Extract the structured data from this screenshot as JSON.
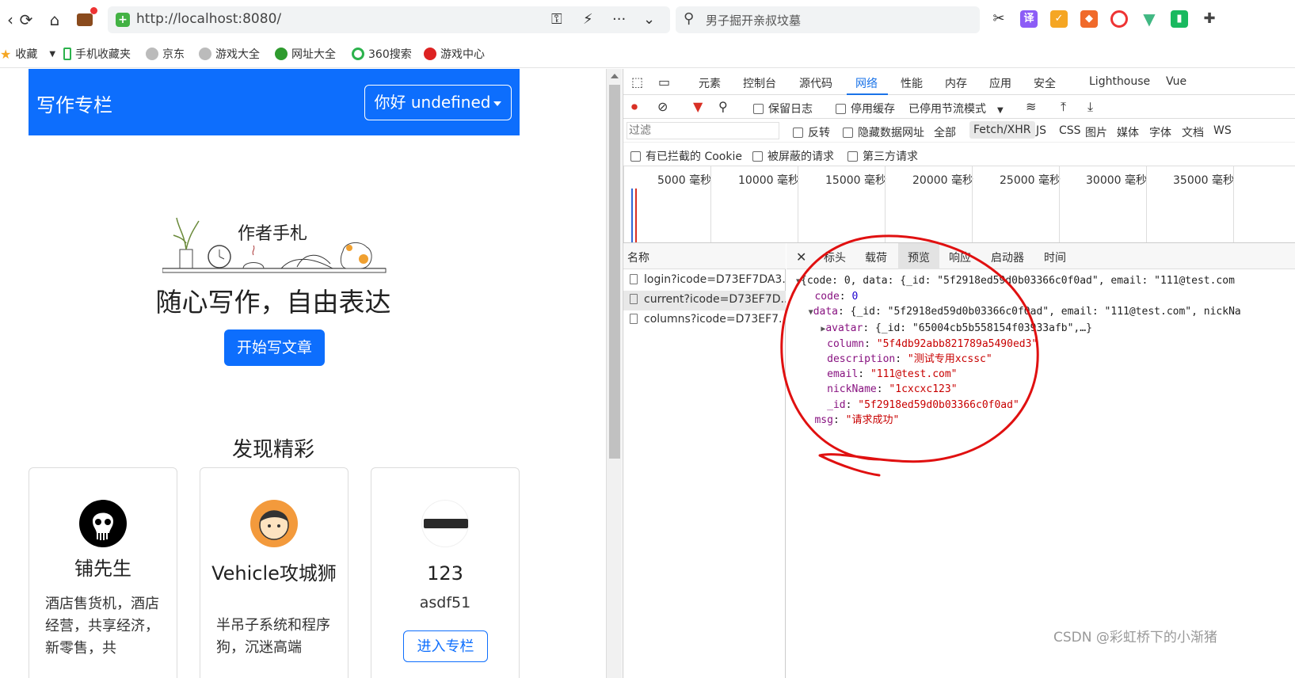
{
  "browser": {
    "url": "http://localhost:8080/",
    "search_text": "男子掘开亲叔坟墓",
    "bookmarks": [
      "收藏",
      "手机收藏夹",
      "京东",
      "游戏大全",
      "网址大全",
      "360搜索",
      "游戏中心"
    ]
  },
  "page": {
    "brand": "写作专栏",
    "user_dropdown": "你好 undefined",
    "hero_small": "作者手札",
    "hero_title": "随心写作，自由表达",
    "start_button": "开始写文章",
    "section_title": "发现精彩",
    "cards": [
      {
        "title": "铺先生",
        "desc": "酒店售货机，酒店经营，共享经济，新零售，共",
        "avatar": "skull-avatar"
      },
      {
        "title": "Vehicle攻城狮",
        "desc": "半吊子系统和程序狗，沉迷高端",
        "avatar": "cartoon-avatar"
      },
      {
        "title": "123",
        "desc": "asdf51",
        "button": "进入专栏",
        "avatar": "bar-avatar"
      }
    ]
  },
  "devtools": {
    "tabs": [
      "元素",
      "控制台",
      "源代码",
      "网络",
      "性能",
      "内存",
      "应用",
      "安全",
      "Lighthouse",
      "Vue"
    ],
    "active_tab": "网络",
    "toolbar": {
      "preserve_log": "保留日志",
      "disable_cache": "停用缓存",
      "throttle": "已停用节流模式"
    },
    "filter": {
      "placeholder": "过滤",
      "invert": "反转",
      "hide_data_urls": "隐藏数据网址",
      "types": [
        "全部",
        "Fetch/XHR",
        "JS",
        "CSS",
        "图片",
        "媒体",
        "字体",
        "文档",
        "WS"
      ],
      "blocked_cookies": "有已拦截的 Cookie",
      "blocked_requests": "被屏蔽的请求",
      "third_party": "第三方请求"
    },
    "timeline_labels": [
      "5000 毫秒",
      "10000 毫秒",
      "15000 毫秒",
      "20000 毫秒",
      "25000 毫秒",
      "30000 毫秒",
      "35000 毫秒"
    ],
    "name_header": "名称",
    "requests": [
      "login?icode=D73EF7DA3...",
      "current?icode=D73EF7D...",
      "columns?icode=D73EF7..."
    ],
    "detail_tabs": [
      "标头",
      "载荷",
      "预览",
      "响应",
      "启动器",
      "时间"
    ],
    "active_detail_tab": "预览",
    "json_lines": {
      "l1_pre": "{code: 0, data: {_id: \"5f2918ed59d0b03366c0f0ad\", email: \"111@test.com",
      "code_key": "code",
      "code_val": "0",
      "data_key": "data",
      "data_summary": "{_id: \"5f2918ed59d0b03366c0f0ad\", email: \"111@test.com\", nickNa",
      "avatar_key": "avatar",
      "avatar_summary": "{_id: \"65004cb5b558154f03933afb\",…}",
      "column_key": "column",
      "column_val": "\"5f4db92abb821789a5490ed3\"",
      "description_key": "description",
      "description_val": "\"测试专用xcssc\"",
      "email_key": "email",
      "email_val": "\"111@test.com\"",
      "nickName_key": "nickName",
      "nickName_val": "\"1cxcxc123\"",
      "id_key": "_id",
      "id_val": "\"5f2918ed59d0b03366c0f0ad\"",
      "msg_key": "msg",
      "msg_val": "\"请求成功\""
    }
  },
  "watermark": "CSDN @彩虹桥下的小渐猪",
  "colors": {
    "primary": "#0d6efd",
    "annotation": "#e01010",
    "devtools_active": "#1a73e8"
  }
}
